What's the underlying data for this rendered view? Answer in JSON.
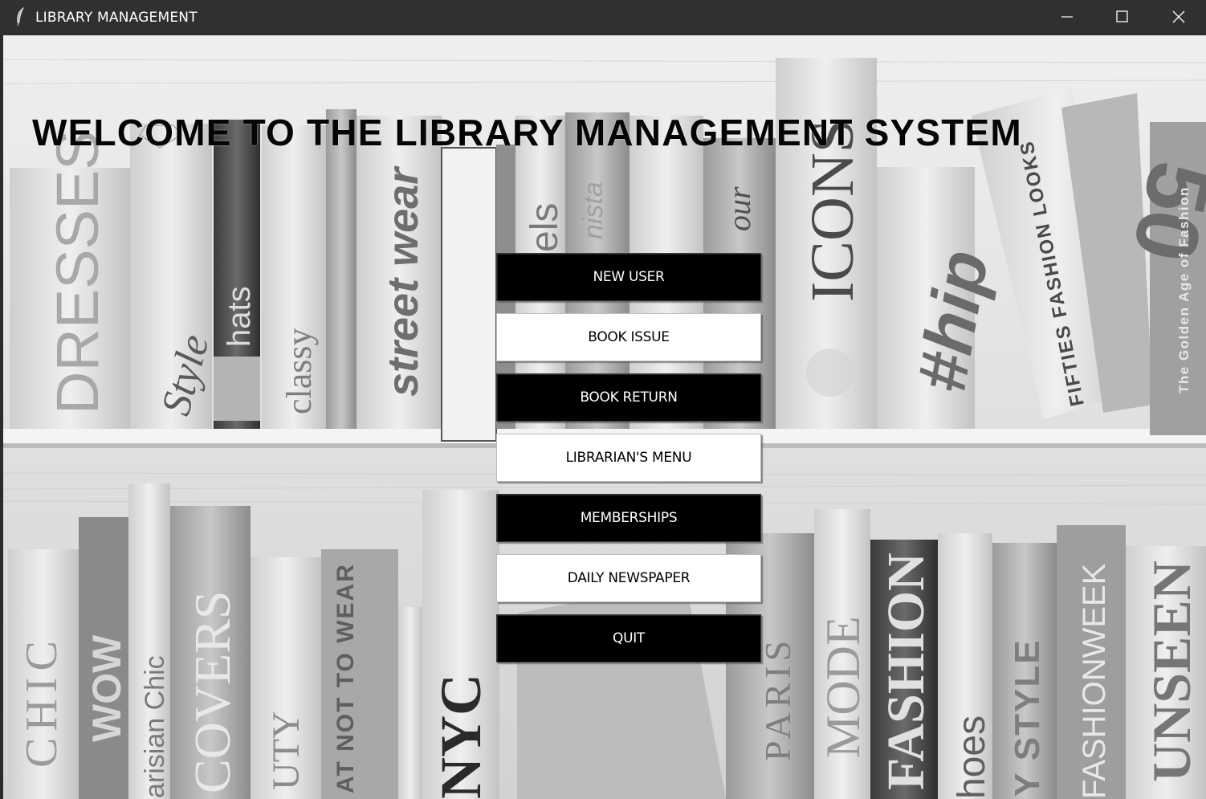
{
  "window": {
    "title": "LIBRARY MANAGEMENT",
    "controls": [
      "minimize-icon",
      "maximize-icon",
      "close-icon"
    ]
  },
  "main": {
    "headline": "WELCOME TO THE LIBRARY MANAGEMENT SYSTEM"
  },
  "menu": {
    "new_user": "NEW USER",
    "book_issue": "BOOK ISSUE",
    "book_return": "BOOK RETURN",
    "librarians_menu": "LIBRARIAN'S MENU",
    "memberships": "MEMBERSHIPS",
    "daily_newspaper": "DAILY NEWSPAPER",
    "quit": "QUIT"
  },
  "background": {
    "book_spines_top": [
      "DRESSES",
      "Style",
      "hats",
      "classy",
      "street wear",
      "els",
      "nista",
      "our",
      "ICONS",
      "#hip",
      "FIFTIES FASHION LOOKS",
      "50",
      "The Golden Age of Fashion"
    ],
    "book_spines_bottom": [
      "CHIC",
      "WOW",
      "arisian Chic",
      "COVERS",
      "UTY",
      "AT NOT TO WEAR",
      "NYC",
      "PARIS",
      "MODE",
      "FASHION",
      "hoes",
      "Y STYLE",
      "FASHIONWEEK",
      "UNSEEN"
    ]
  },
  "colors": {
    "titlebar": "#303030",
    "button_dark": "#000000",
    "button_light": "#ffffff"
  }
}
